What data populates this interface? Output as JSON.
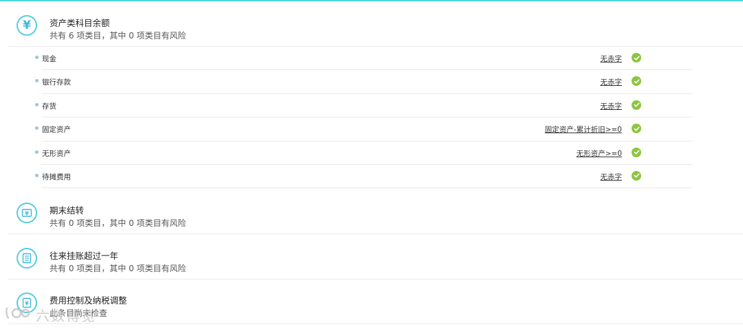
{
  "sections": [
    {
      "title": "资产类科目余额",
      "subtitle": "共有 6 项类目，其中 0 项类目有风险",
      "icon": "yuan-icon",
      "items": [
        {
          "label": "现金",
          "rule": "无赤字",
          "status": "ok"
        },
        {
          "label": "银行存款",
          "rule": "无赤字",
          "status": "ok"
        },
        {
          "label": "存货",
          "rule": "无赤字",
          "status": "ok"
        },
        {
          "label": "固定资产",
          "rule": "固定资产-累计折旧>=0",
          "status": "ok"
        },
        {
          "label": "无形资产",
          "rule": "无形资产>=0",
          "status": "ok"
        },
        {
          "label": "待摊费用",
          "rule": "无赤字",
          "status": "ok"
        }
      ]
    },
    {
      "title": "期末结转",
      "subtitle": "共有 0 项类目，其中 0 项类目有风险",
      "icon": "money-card-icon"
    },
    {
      "title": "往来挂账超过一年",
      "subtitle": "共有 0 项类目，其中 0 项类目有风险",
      "icon": "document-list-icon"
    },
    {
      "title": "费用控制及纳税调整",
      "subtitle": "此条目尚未检查",
      "icon": "receipt-icon"
    }
  ],
  "watermark": {
    "text": "六数博览"
  },
  "colors": {
    "accent": "#4dd6d6",
    "icon": "#57cbe3",
    "ok": "#8cc63f"
  }
}
